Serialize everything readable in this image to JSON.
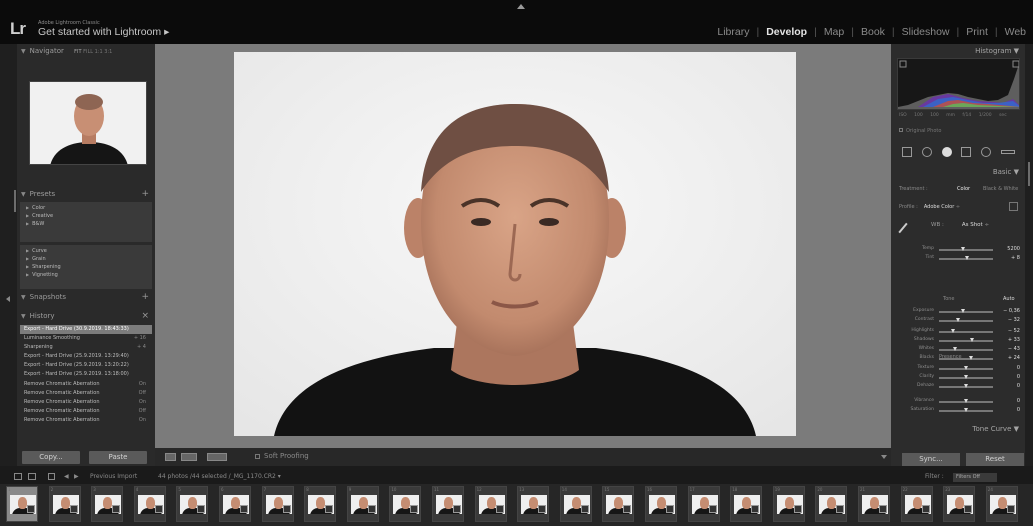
{
  "app": {
    "logo": "Lr",
    "brand_small": "Adobe Lightroom Classic",
    "brand_main": "Get started with Lightroom",
    "brand_arrow": "▸"
  },
  "modules": [
    "Library",
    "Develop",
    "Map",
    "Book",
    "Slideshow",
    "Print",
    "Web"
  ],
  "active_module": "Develop",
  "left": {
    "navigator": {
      "title": "Navigator",
      "zoom": [
        "FIT",
        "FILL",
        "1:1",
        "3:1"
      ]
    },
    "presets": {
      "title": "Presets",
      "group1": [
        "Color",
        "Creative",
        "B&W"
      ],
      "group2": [
        "Curve",
        "Grain",
        "Sharpening",
        "Vignetting"
      ]
    },
    "snapshots": {
      "title": "Snapshots"
    },
    "history": {
      "title": "History",
      "items": [
        {
          "label": "Export - Hard Drive (30.9.2019. 18:43:33)",
          "value": ""
        },
        {
          "label": "Luminance Smoothing",
          "value": "+ 16"
        },
        {
          "label": "Sharpening",
          "value": "+ 4"
        },
        {
          "label": "Export - Hard Drive (25.9.2019. 13:29:40)",
          "value": ""
        },
        {
          "label": "Export - Hard Drive (25.9.2019. 13:20:22)",
          "value": ""
        },
        {
          "label": "Export - Hard Drive (25.9.2019. 13:18:00)",
          "value": ""
        },
        {
          "label": "Remove Chromatic Aberration",
          "value": "On"
        },
        {
          "label": "Remove Chromatic Aberration",
          "value": "Off"
        },
        {
          "label": "Remove Chromatic Aberration",
          "value": "On"
        },
        {
          "label": "Remove Chromatic Aberration",
          "value": "Off"
        },
        {
          "label": "Remove Chromatic Aberration",
          "value": "On"
        }
      ]
    },
    "copy_label": "Copy...",
    "paste_label": "Paste"
  },
  "toolbar": {
    "soft_proofing": "Soft Proofing"
  },
  "right": {
    "histogram_title": "Histogram",
    "hist_info": [
      "ISO 100",
      "100 mm",
      "f/14",
      "1/200 sec"
    ],
    "original_photo": "Original Photo",
    "basic_title": "Basic",
    "treatment_label": "Treatment :",
    "treatment_color": "Color",
    "treatment_bw": "Black & White",
    "profile_label": "Profile :",
    "profile_value": "Adobe Color",
    "wb_label": "WB :",
    "wb_value": "As Shot",
    "tone_label": "Tone",
    "auto_label": "Auto",
    "presence_label": "Presence",
    "sliders_wb": [
      {
        "label": "Temp",
        "value": "5200",
        "pos": 0.45
      },
      {
        "label": "Tint",
        "value": "+ 8",
        "pos": 0.52
      }
    ],
    "sliders_tone": [
      {
        "label": "Exposure",
        "value": "− 0,36",
        "pos": 0.45
      },
      {
        "label": "Contrast",
        "value": "− 32",
        "pos": 0.35
      }
    ],
    "sliders_tone2": [
      {
        "label": "Highlights",
        "value": "− 52",
        "pos": 0.25
      },
      {
        "label": "Shadows",
        "value": "+ 33",
        "pos": 0.62
      },
      {
        "label": "Whites",
        "value": "− 43",
        "pos": 0.3
      },
      {
        "label": "Blacks",
        "value": "+ 24",
        "pos": 0.6
      }
    ],
    "sliders_presence": [
      {
        "label": "Texture",
        "value": "0",
        "pos": 0.5
      },
      {
        "label": "Clarity",
        "value": "0",
        "pos": 0.5
      },
      {
        "label": "Dehaze",
        "value": "0",
        "pos": 0.5
      }
    ],
    "sliders_presence2": [
      {
        "label": "Vibrance",
        "value": "0",
        "pos": 0.5
      },
      {
        "label": "Saturation",
        "value": "0",
        "pos": 0.5
      }
    ],
    "tone_curve_title": "Tone Curve",
    "sync_label": "Sync...",
    "reset_label": "Reset"
  },
  "filmstrip": {
    "source": "Previous Import",
    "info": "44 photos /44 selected /_MG_1170.CR2",
    "filter_label": "Filter :",
    "filter_value": "Filters Off",
    "count": 24,
    "selected_index": 0
  }
}
